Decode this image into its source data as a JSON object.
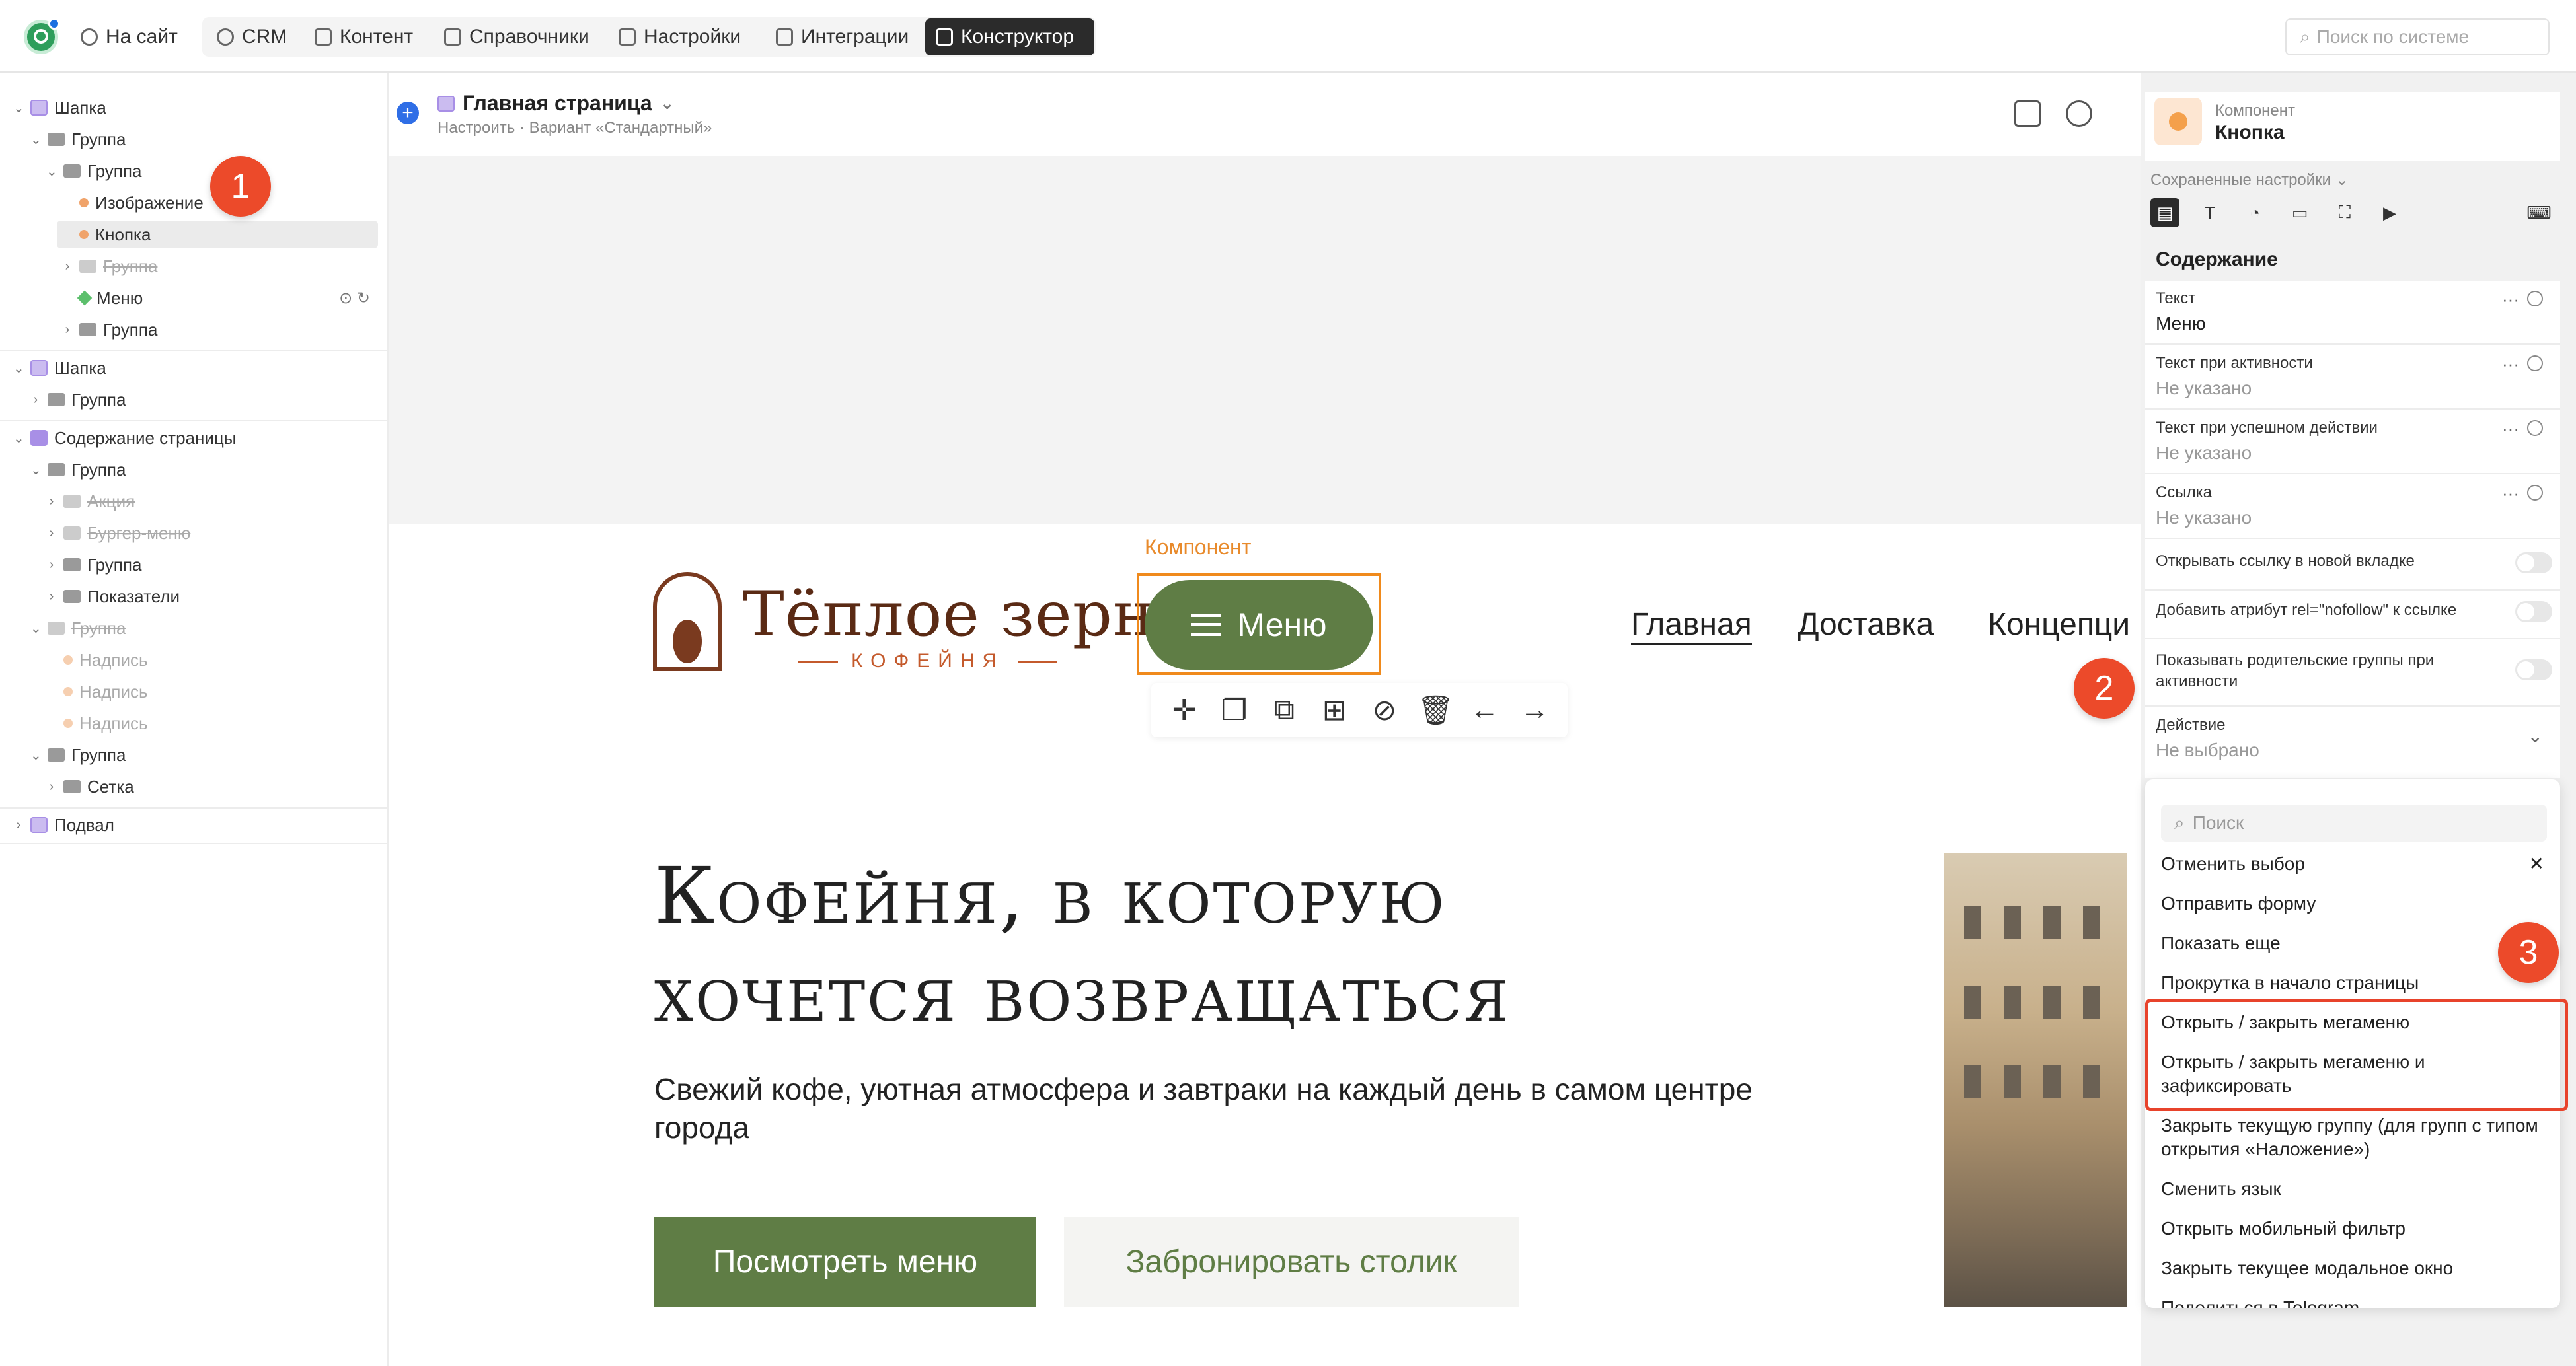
{
  "topbar": {
    "items": [
      {
        "label": "На сайт",
        "icon": "external-link-icon"
      },
      {
        "label": "CRM",
        "icon": "crm-icon"
      },
      {
        "label": "Контент",
        "icon": "content-icon"
      },
      {
        "label": "Справочники",
        "icon": "book-icon"
      },
      {
        "label": "Настройки",
        "icon": "settings-icon"
      },
      {
        "label": "Интеграции",
        "icon": "plus-square-icon"
      },
      {
        "label": "Конструктор",
        "icon": "brush-icon",
        "active": true
      }
    ],
    "search_placeholder": "Поиск по системе"
  },
  "tree": {
    "nodes": [
      {
        "label": "Шапка"
      },
      {
        "label": "Группа"
      },
      {
        "label": "Группа"
      },
      {
        "label": "Изображение"
      },
      {
        "label": "Кнопка",
        "selected": true
      },
      {
        "label": "Группа",
        "hidden": true
      },
      {
        "label": "Меню"
      },
      {
        "label": "Группа"
      },
      {
        "label": "Шапка"
      },
      {
        "label": "Группа"
      },
      {
        "label": "Содержание страницы"
      },
      {
        "label": "Группа"
      },
      {
        "label": "Акция",
        "hidden": true
      },
      {
        "label": "Бургер-меню",
        "hidden": true
      },
      {
        "label": "Группа"
      },
      {
        "label": "Показатели"
      },
      {
        "label": "Группа",
        "hidden": true
      },
      {
        "label": "Надпись",
        "muted": true
      },
      {
        "label": "Надпись",
        "muted": true
      },
      {
        "label": "Надпись",
        "muted": true
      },
      {
        "label": "Группа"
      },
      {
        "label": "Сетка"
      },
      {
        "label": "Подвал"
      }
    ]
  },
  "badges": [
    "1",
    "2",
    "3"
  ],
  "workspace": {
    "page_title": "Главная страница",
    "page_subtitle": "Настроить · Вариант «Стандартный»"
  },
  "preview": {
    "component_label": "Компонент",
    "menu_button": "Меню",
    "brand_name": "Тёплое зерно",
    "brand_sub": "КОФЕЙНЯ",
    "nav": [
      "Главная",
      "Доставка",
      "Концепци"
    ],
    "hero_line1": "Кофейня, в которую",
    "hero_line2": "хочется возвращаться",
    "hero_sub": "Свежий кофе, уютная атмосфера и завтраки на каждый день в самом центре города",
    "btn_menu": "Посмотреть меню",
    "btn_book": "Забронировать столик"
  },
  "panel": {
    "component_caption": "Компонент",
    "component_name": "Кнопка",
    "saved_settings": "Сохраненные настройки",
    "section": "Содержание",
    "fields": [
      {
        "label": "Текст",
        "value": "Меню"
      },
      {
        "label": "Текст при активности",
        "value": "Не указано"
      },
      {
        "label": "Текст при успешном действии",
        "value": "Не указано"
      },
      {
        "label": "Ссылка",
        "value": "Не указано"
      }
    ],
    "toggles": [
      "Открывать ссылку в новой вкладке",
      "Добавить атрибут rel=\"nofollow\" к ссылке",
      "Показывать родительские группы при активности"
    ],
    "action_label": "Действие",
    "action_value": "Не выбрано"
  },
  "dropdown": {
    "search_placeholder": "Поиск",
    "items": [
      "Отменить выбор",
      "Отправить форму",
      "Показать еще",
      "Прокрутка в начало страницы",
      "Открыть / закрыть мегаменю",
      "Открыть / закрыть мегаменю и зафиксировать",
      "Закрыть текущую группу (для групп с типом открытия «Наложение»)",
      "Сменить язык",
      "Открыть мобильный фильтр",
      "Закрыть текущее модальное окно",
      "Поделиться в Telegram"
    ]
  },
  "colors": {
    "accent_green": "#5f7d45",
    "highlight_orange": "#f08a1c",
    "badge_red": "#ec4a2a",
    "brand_brown": "#5a2a14"
  }
}
